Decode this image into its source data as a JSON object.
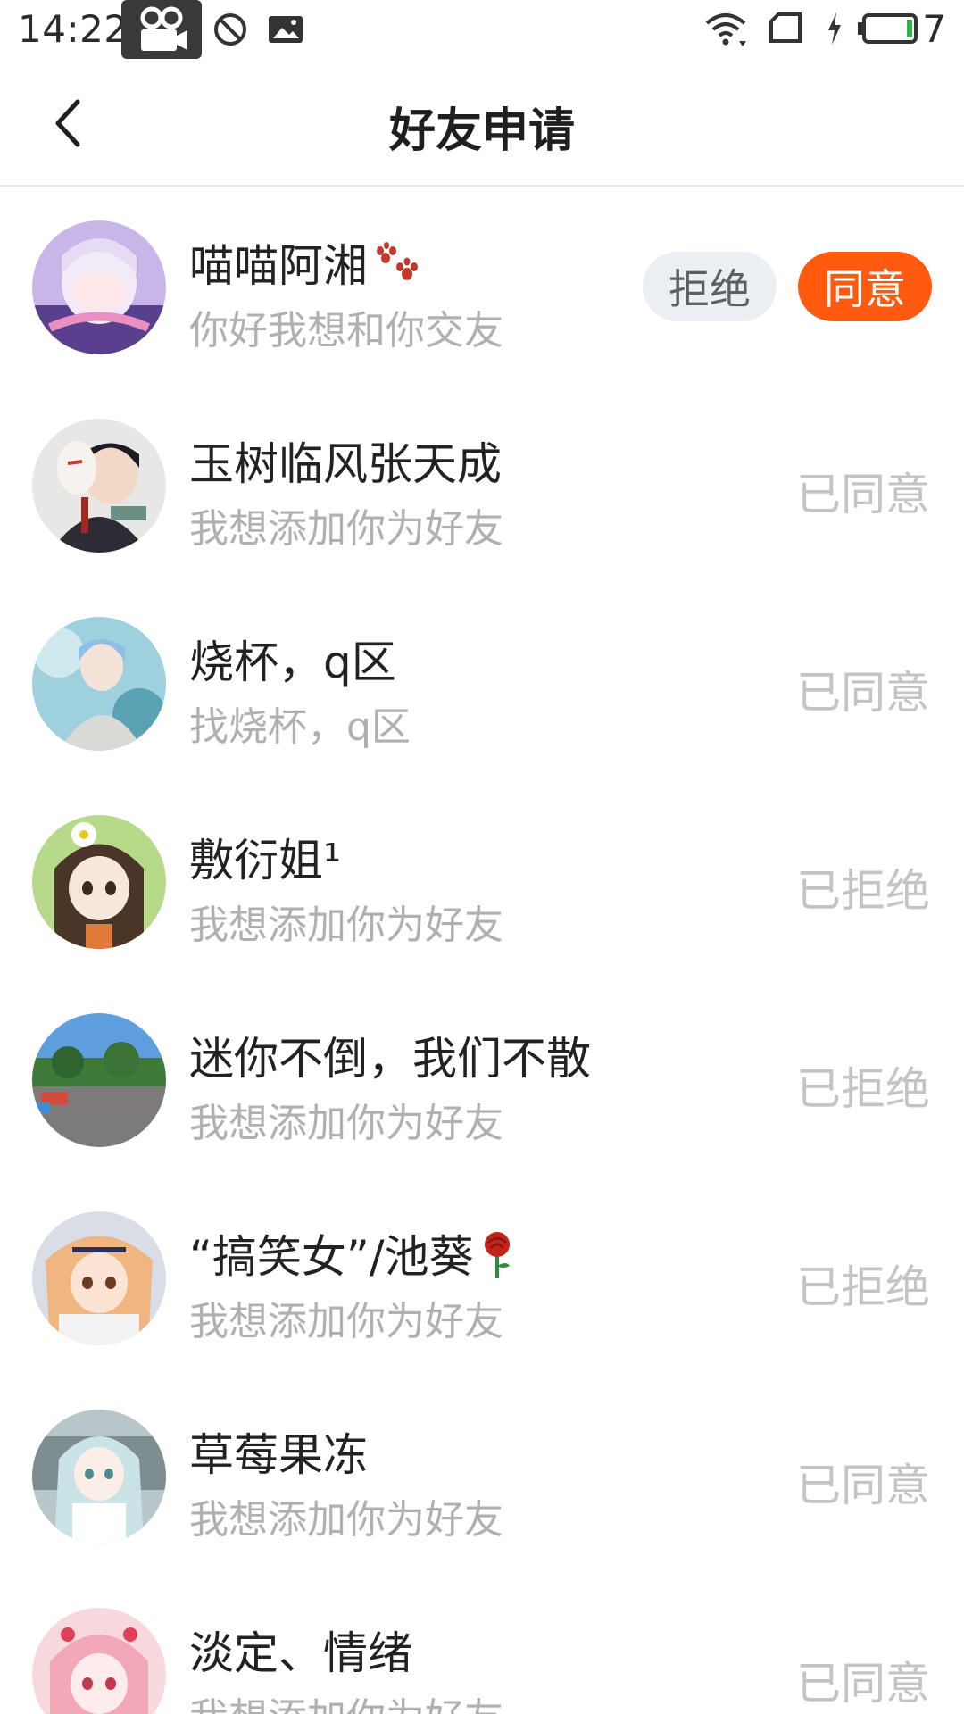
{
  "status_bar": {
    "time": "14:22",
    "battery_level": "7",
    "icons": [
      "video-camera-icon",
      "do-not-disturb-icon",
      "image-icon",
      "wifi-icon",
      "sim-card-icon",
      "charging-icon",
      "battery-icon"
    ]
  },
  "header": {
    "title": "好友申请",
    "back_icon": "chevron-left-icon"
  },
  "colors": {
    "accent": "#ff5a0f",
    "reject_bg": "#ebeef2",
    "muted_text": "#b0b0b0",
    "status_text": "#c4c4c4"
  },
  "requests": [
    {
      "name": "喵喵阿湘",
      "name_emoji": "paw-prints-icon",
      "message": "你好我想和你交友",
      "reject_label": "拒绝",
      "accept_label": "同意"
    },
    {
      "name": "玉树临风张天成",
      "message": "我想添加你为好友",
      "status": "已同意"
    },
    {
      "name": "烧杯，q区",
      "message": "找烧杯，q区",
      "status": "已同意"
    },
    {
      "name": "敷衍姐¹",
      "message": "我想添加你为好友",
      "status": "已拒绝"
    },
    {
      "name": "迷你不倒，我们不散",
      "message": "我想添加你为好友",
      "status": "已拒绝"
    },
    {
      "name": "“搞笑女”/池葵",
      "name_emoji": "rose-icon",
      "message": "我想添加你为好友",
      "status": "已拒绝"
    },
    {
      "name": "草莓果冻",
      "message": "我想添加你为好友",
      "status": "已同意"
    },
    {
      "name": "淡定、情绪",
      "message": "我想添加你为好友",
      "status": "已同意"
    }
  ]
}
